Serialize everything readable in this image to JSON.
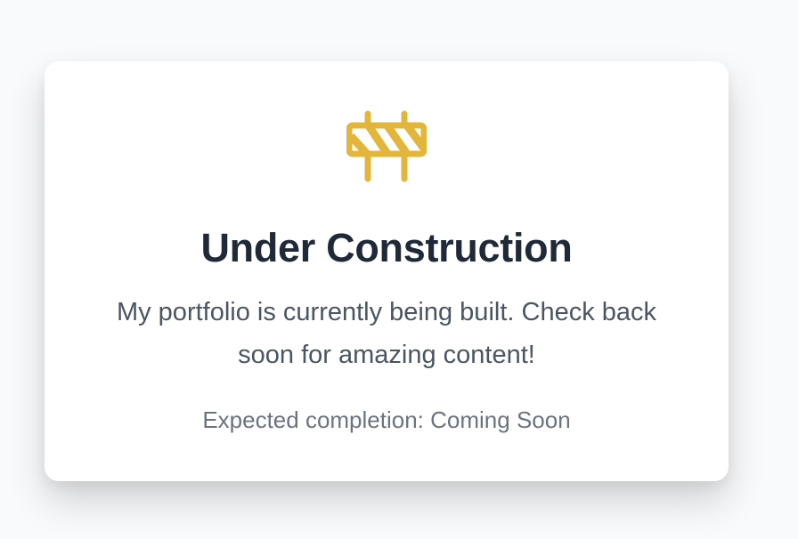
{
  "card": {
    "icon": "road-barrier-icon",
    "title": "Under Construction",
    "message": "My portfolio is currently being built. Check back soon for amazing content!",
    "expected_completion": "Expected completion: Coming Soon"
  },
  "colors": {
    "page_background": "#f9fafb",
    "card_background": "#ffffff",
    "icon_accent": "#e3b53b",
    "title": "#1f2937",
    "body_text": "#4b5563",
    "secondary_text": "#6b7280"
  }
}
